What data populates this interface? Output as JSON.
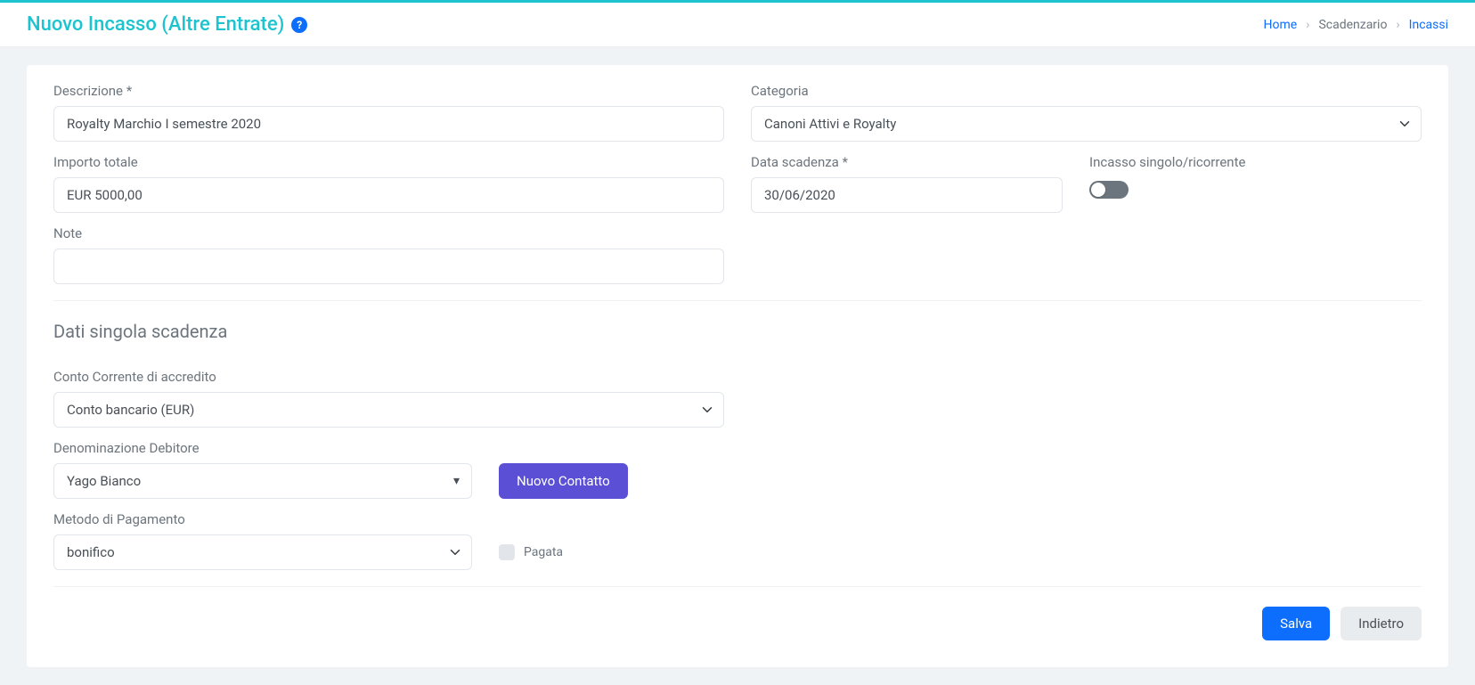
{
  "header": {
    "title": "Nuovo Incasso (Altre Entrate)",
    "help_icon": "?"
  },
  "breadcrumb": {
    "home": "Home",
    "item1": "Scadenzario",
    "item2": "Incassi"
  },
  "form": {
    "descrizione_label": "Descrizione *",
    "descrizione_value": "Royalty Marchio I semestre 2020",
    "categoria_label": "Categoria",
    "categoria_value": "Canoni Attivi e Royalty",
    "importo_label": "Importo totale",
    "importo_value": "EUR 5000,00",
    "data_scadenza_label": "Data scadenza *",
    "data_scadenza_value": "30/06/2020",
    "ricorrente_label": "Incasso singolo/ricorrente",
    "note_label": "Note",
    "note_value": ""
  },
  "section2": {
    "title": "Dati singola scadenza",
    "conto_label": "Conto Corrente di accredito",
    "conto_value": "Conto bancario (EUR)",
    "debitore_label": "Denominazione Debitore",
    "debitore_value": "Yago Bianco",
    "nuovo_contatto": "Nuovo Contatto",
    "metodo_label": "Metodo di Pagamento",
    "metodo_value": "bonifico",
    "pagata_label": "Pagata"
  },
  "actions": {
    "save": "Salva",
    "back": "Indietro"
  }
}
